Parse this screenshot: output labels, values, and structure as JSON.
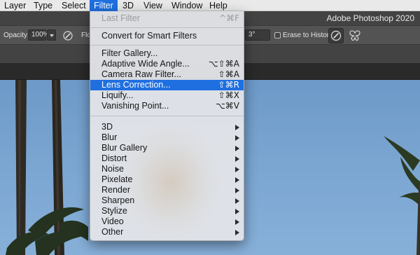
{
  "menubar": {
    "items": [
      "Layer",
      "Type",
      "Select",
      "Filter",
      "3D",
      "View",
      "Window",
      "Help"
    ]
  },
  "app": {
    "title": "Adobe Photoshop 2020"
  },
  "options_bar": {
    "opacity_label": "Opacity:",
    "opacity_value": "100%",
    "flow_label_partial": "Flo",
    "angle_value": "3°",
    "erase_to_history_label": "Erase to History"
  },
  "filter_menu": {
    "last_filter": {
      "label": "Last Filter",
      "shortcut": "^⌘F"
    },
    "convert_smart": {
      "label": "Convert for Smart Filters"
    },
    "filter_gallery": {
      "label": "Filter Gallery..."
    },
    "adaptive_wide_angle": {
      "label": "Adaptive Wide Angle...",
      "shortcut": "⌥⇧⌘A"
    },
    "camera_raw": {
      "label": "Camera Raw Filter...",
      "shortcut": "⇧⌘A"
    },
    "lens_correction": {
      "label": "Lens Correction...",
      "shortcut": "⇧⌘R"
    },
    "liquify": {
      "label": "Liquify...",
      "shortcut": "⇧⌘X"
    },
    "vanishing_point": {
      "label": "Vanishing Point...",
      "shortcut": "⌥⌘V"
    },
    "submenus": [
      "3D",
      "Blur",
      "Blur Gallery",
      "Distort",
      "Noise",
      "Pixelate",
      "Render",
      "Sharpen",
      "Stylize",
      "Video",
      "Other"
    ]
  },
  "colors": {
    "menu_highlight": "#1f6fe0",
    "sky": "#7aa5d1",
    "options_bar": "#535353"
  }
}
